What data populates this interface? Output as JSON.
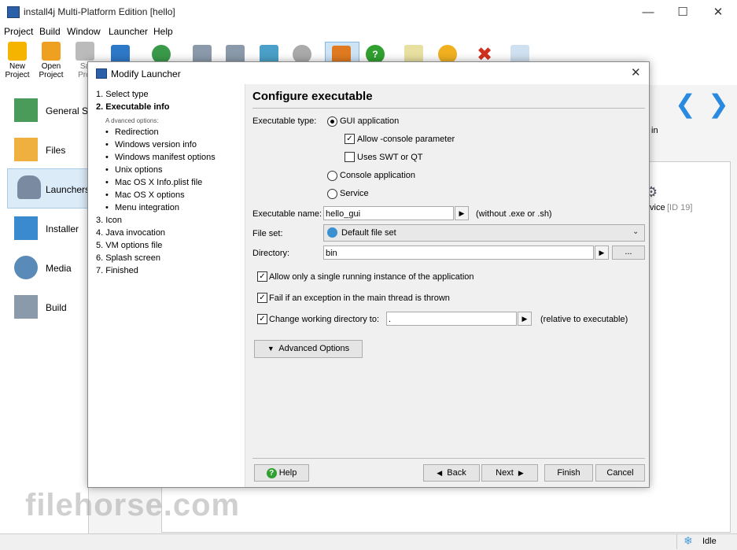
{
  "window": {
    "title": "install4j Multi-Platform Edition [hello]"
  },
  "menu": [
    "Project",
    "Build",
    "Window",
    "Launcher",
    "Help"
  ],
  "toolbar": {
    "new_project": [
      "New",
      "Project"
    ],
    "open_project": [
      "Open",
      "Project"
    ],
    "save_project": [
      "Sa",
      "Proj"
    ]
  },
  "nav": [
    "General Se",
    "Files",
    "Launchers",
    "Installer",
    "Media",
    "Build"
  ],
  "background": {
    "right_text": "in",
    "service_text": "vice",
    "service_id": "[ID 19]",
    "watermark": "filehorse.com"
  },
  "status": "Idle",
  "dialog": {
    "title": "Modify Launcher",
    "steps": {
      "s1": "1. Select type",
      "s2": "2. Executable info",
      "advanced_label": "A dvanced options:",
      "subs": [
        "Redirection",
        "Windows version info",
        "Windows manifest options",
        "Unix options",
        "Mac OS X Info.plist file",
        "Mac OS X options",
        "Menu integration"
      ],
      "rest": [
        "3. Icon",
        "4. Java invocation",
        "5. VM options file",
        "6. Splash screen",
        "7. Finished"
      ]
    },
    "heading": "Configure executable",
    "exe_type_label": "Executable type:",
    "gui_app": "GUI application",
    "allow_console": "Allow -console parameter",
    "uses_swt": "Uses SWT or QT",
    "console_app": "Console application",
    "service": "Service",
    "exe_name_label": "Executable name:",
    "exe_name_value": "hello_gui",
    "exe_name_hint": "(without .exe or .sh)",
    "fileset_label": "File set:",
    "fileset_value": "Default file set",
    "directory_label": "Directory:",
    "directory_value": "bin",
    "browse": "...",
    "single_instance": "Allow only a single running instance of the application",
    "fail_exception": "Fail if an exception in the main thread is thrown",
    "change_wd": "Change working directory to:",
    "change_wd_value": ".",
    "relative_hint": "(relative to executable)",
    "advanced_btn": "Advanced Options",
    "help_btn": "Help",
    "back_btn": "Back",
    "next_btn": "Next",
    "finish_btn": "Finish",
    "cancel_btn": "Cancel"
  }
}
